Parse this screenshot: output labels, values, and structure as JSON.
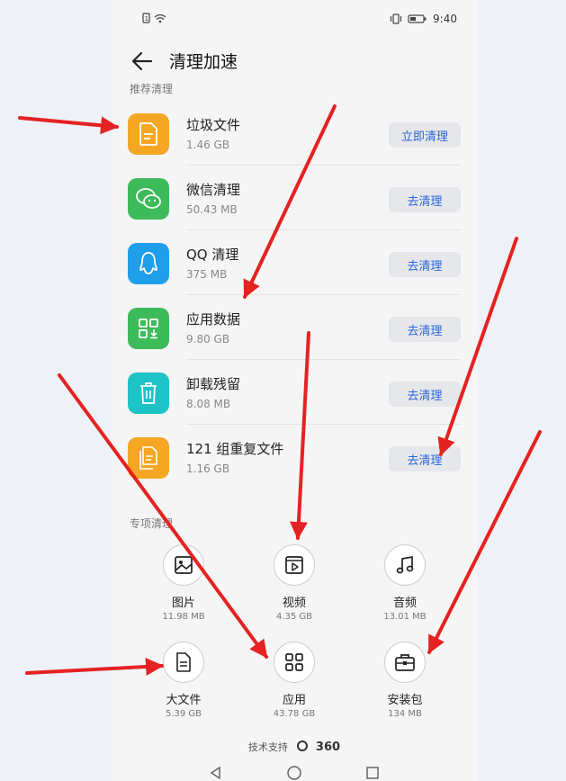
{
  "status": {
    "time": "9:40"
  },
  "header": {
    "title": "清理加速"
  },
  "recommended": {
    "label": "推荐清理",
    "items": [
      {
        "name": "垃圾文件",
        "size": "1.46 GB",
        "button": "立即清理",
        "icon": "file-icon",
        "color": "#f5a623"
      },
      {
        "name": "微信清理",
        "size": "50.43 MB",
        "button": "去清理",
        "icon": "wechat-icon",
        "color": "#3dbb5a"
      },
      {
        "name": "QQ 清理",
        "size": "375 MB",
        "button": "去清理",
        "icon": "qq-icon",
        "color": "#1f9eea"
      },
      {
        "name": "应用数据",
        "size": "9.80 GB",
        "button": "去清理",
        "icon": "app-data-icon",
        "color": "#3dbb5a"
      },
      {
        "name": "卸载残留",
        "size": "8.08 MB",
        "button": "去清理",
        "icon": "trash-icon",
        "color": "#1ec3c7"
      },
      {
        "name": "121 组重复文件",
        "size": "1.16 GB",
        "button": "去清理",
        "icon": "duplicate-file-icon",
        "color": "#f5a623"
      }
    ]
  },
  "special": {
    "label": "专项清理",
    "items": [
      {
        "name": "图片",
        "size": "11.98 MB",
        "icon": "image-icon"
      },
      {
        "name": "视频",
        "size": "4.35 GB",
        "icon": "video-icon"
      },
      {
        "name": "音频",
        "size": "13.01 MB",
        "icon": "music-icon"
      },
      {
        "name": "大文件",
        "size": "5.39 GB",
        "icon": "document-icon"
      },
      {
        "name": "应用",
        "size": "43.78 GB",
        "icon": "apps-grid-icon"
      },
      {
        "name": "安装包",
        "size": "134 MB",
        "icon": "briefcase-icon"
      }
    ]
  },
  "footer": {
    "text": "技术支持",
    "brand": "360"
  },
  "colors": {
    "accent": "#2a66d9",
    "annotation": "#e52222"
  }
}
